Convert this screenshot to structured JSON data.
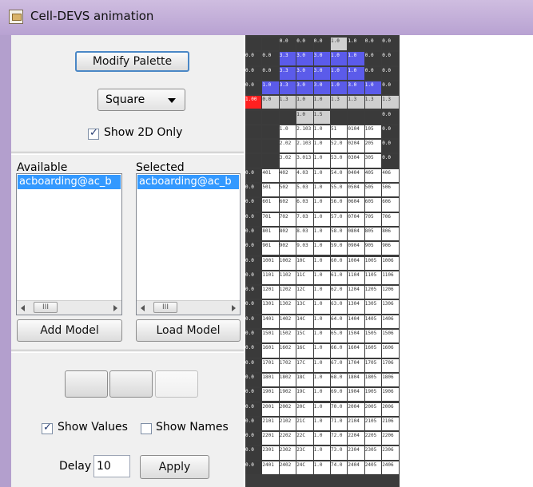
{
  "window": {
    "title": "Cell-DEVS animation",
    "icon": "app-window-icon"
  },
  "controls": {
    "modify_palette_label": "Modify Palette",
    "shape_select": {
      "selected": "Square",
      "icon": "chevron-down-icon"
    },
    "show_2d_only": {
      "label": "Show 2D Only",
      "checked": true
    }
  },
  "models": {
    "available_label": "Available",
    "selected_label": "Selected",
    "available_items": [
      "acboarding@ac_b"
    ],
    "selected_items": [
      "acboarding@ac_b"
    ],
    "scroll_thumb_glyph": "III",
    "add_model_label": "Add Model",
    "load_model_label": "Load Model"
  },
  "playback": {
    "show_values": {
      "label": "Show Values",
      "checked": true
    },
    "show_names": {
      "label": "Show Names",
      "checked": false
    },
    "delay_label": "Delay",
    "delay_value": "10",
    "apply_label": "Apply"
  },
  "colors": {
    "dark": "#3a3a3a",
    "light": "#ffffff",
    "lightgray": "#cfcfcf",
    "blue": "#5b5bea",
    "red": "#ff2020",
    "midgray": "#9a9a9a"
  },
  "grid_data": {
    "rows": [
      [
        "D",
        "D",
        "D:0.0",
        "D:0.0",
        "D:0.0",
        "L:1.0",
        "D:1.0",
        "D:0.0",
        "D:0.0"
      ],
      [
        "D:0.0",
        "D:0.0",
        "B:3.3",
        "B:3.0",
        "B:3.0",
        "B:1.0",
        "B:1.0",
        "D:0.0",
        "D:0.0"
      ],
      [
        "D:0.0",
        "D:0.0",
        "B:3.3",
        "B:3.0",
        "B:3.0",
        "B:1.0",
        "B:1.0",
        "D:0.0",
        "D:0.0"
      ],
      [
        "D:0.0",
        "B:1.0",
        "B:3.3",
        "B:3.0",
        "B:3.0",
        "B:1.0",
        "B:3.0",
        "B:1.0",
        "D:0.0"
      ],
      [
        "R:1.00",
        "G:0.0",
        "G:1.3",
        "G:1.0",
        "G:1.0",
        "G:1.3",
        "G:1.3",
        "G:1.3",
        "G:1.3"
      ],
      [
        "D",
        "D",
        "D",
        "L:1.0",
        "L:1.5",
        "D",
        "D",
        "D",
        "D:0.0"
      ],
      [
        "D",
        "D",
        "W:1.0",
        "W:2.103",
        "W:1.0",
        "W:51",
        "W:0104",
        "W:105",
        "D:0.0"
      ],
      [
        "D",
        "D",
        "W:2.02",
        "W:2.103",
        "W:1.0",
        "W:52.0",
        "W:0204",
        "W:205",
        "D:0.0"
      ],
      [
        "D",
        "D",
        "W:3.02",
        "W:3.013",
        "W:1.0",
        "W:53.0",
        "W:0304",
        "W:305",
        "D:0.0"
      ],
      [
        "D:0.0",
        "W:401",
        "W:402",
        "W:4.03",
        "W:1.0",
        "W:54.0",
        "W:0404",
        "W:405",
        "W:406"
      ],
      [
        "D:0.0",
        "W:501",
        "W:502",
        "W:5.03",
        "W:1.0",
        "W:55.0",
        "W:0504",
        "W:505",
        "W:506"
      ],
      [
        "D:0.0",
        "W:601",
        "W:602",
        "W:6.03",
        "W:1.0",
        "W:56.0",
        "W:0604",
        "W:605",
        "W:606"
      ],
      [
        "D:0.0",
        "W:701",
        "W:702",
        "W:7.03",
        "W:1.0",
        "W:57.0",
        "W:0704",
        "W:705",
        "W:706"
      ],
      [
        "D:0.0",
        "W:801",
        "W:802",
        "W:8.03",
        "W:1.0",
        "W:58.0",
        "W:0804",
        "W:805",
        "W:806"
      ],
      [
        "D:0.0",
        "W:901",
        "W:902",
        "W:9.03",
        "W:1.0",
        "W:59.0",
        "W:0904",
        "W:905",
        "W:906"
      ],
      [
        "D:0.0",
        "W:1001",
        "W:1002",
        "W:10C",
        "W:1.0",
        "W:60.0",
        "W:1004",
        "W:1005",
        "W:1006"
      ],
      [
        "D:0.0",
        "W:1101",
        "W:1102",
        "W:11C",
        "W:1.0",
        "W:61.0",
        "W:1104",
        "W:1105",
        "W:1106"
      ],
      [
        "D:0.0",
        "W:1201",
        "W:1202",
        "W:12C",
        "W:1.0",
        "W:62.0",
        "W:1204",
        "W:1205",
        "W:1206"
      ],
      [
        "D:0.0",
        "W:1301",
        "W:1302",
        "W:13C",
        "W:1.0",
        "W:63.0",
        "W:1304",
        "W:1305",
        "W:1306"
      ],
      [
        "D:0.0",
        "W:1401",
        "W:1402",
        "W:14C",
        "W:1.0",
        "W:64.0",
        "W:1404",
        "W:1405",
        "W:1406"
      ],
      [
        "D:0.0",
        "W:1501",
        "W:1502",
        "W:15C",
        "W:1.0",
        "W:65.0",
        "W:1504",
        "W:1505",
        "W:1506"
      ],
      [
        "D:0.0",
        "W:1601",
        "W:1602",
        "W:16C",
        "W:1.0",
        "W:66.0",
        "W:1604",
        "W:1605",
        "W:1606"
      ],
      [
        "D:0.0",
        "W:1701",
        "W:1702",
        "W:17C",
        "W:1.0",
        "W:67.0",
        "W:1704",
        "W:1705",
        "W:1706"
      ],
      [
        "D:0.0",
        "W:1801",
        "W:1802",
        "W:18C",
        "W:1.0",
        "W:68.0",
        "W:1804",
        "W:1805",
        "W:1806"
      ],
      [
        "D:0.0",
        "W:1901",
        "W:1902",
        "W:19C",
        "W:1.0",
        "W:69.0",
        "W:1904",
        "W:1905",
        "W:1906"
      ],
      [
        "D:0.0",
        "W:2001",
        "W:2002",
        "W:20C",
        "W:1.0",
        "W:70.0",
        "W:2004",
        "W:2005",
        "W:2006"
      ],
      [
        "D:0.0",
        "W:2101",
        "W:2102",
        "W:21C",
        "W:1.0",
        "W:71.0",
        "W:2104",
        "W:2105",
        "W:2106"
      ],
      [
        "D:0.0",
        "W:2201",
        "W:2202",
        "W:22C",
        "W:1.0",
        "W:72.0",
        "W:2204",
        "W:2205",
        "W:2206"
      ],
      [
        "D:0.0",
        "W:2301",
        "W:2302",
        "W:23C",
        "W:1.0",
        "W:73.0",
        "W:2304",
        "W:2305",
        "W:2306"
      ],
      [
        "D:0.0",
        "W:2401",
        "W:2402",
        "W:24C",
        "W:1.0",
        "W:74.0",
        "W:2404",
        "W:2405",
        "W:2406"
      ]
    ]
  }
}
